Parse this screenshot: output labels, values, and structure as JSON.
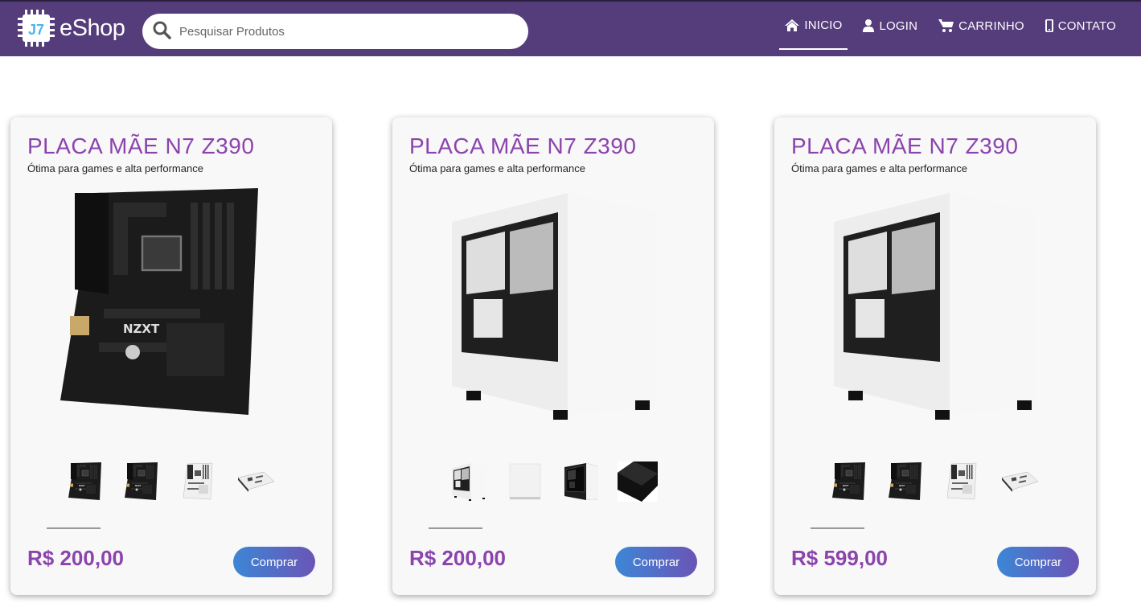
{
  "brand": {
    "logo_letters": "J7",
    "name": "eShop"
  },
  "search": {
    "placeholder": "Pesquisar Produtos",
    "icon": "search-icon"
  },
  "nav": {
    "items": [
      {
        "label": "INICIO",
        "icon": "home-icon",
        "active": true
      },
      {
        "label": "LOGIN",
        "icon": "user-icon",
        "active": false
      },
      {
        "label": "CARRINHO",
        "icon": "cart-icon",
        "active": false
      },
      {
        "label": "CONTATO",
        "icon": "mobile-icon",
        "active": false
      }
    ]
  },
  "colors": {
    "navbar": "#553c7b",
    "accent": "#8b44ad",
    "button_from": "#3d86d6",
    "button_to": "#6a55b6"
  },
  "products": [
    {
      "title": "PLACA MÃE N7 Z390",
      "subtitle": "Ótima para games e alta performance",
      "image": "motherboard-black",
      "thumbnails": [
        "motherboard-black",
        "motherboard-black",
        "motherboard-white",
        "motherboard-white-angle"
      ],
      "price": "R$ 200,00",
      "button": "Comprar"
    },
    {
      "title": "PLACA MÃE N7 Z390",
      "subtitle": "Ótima para games e alta performance",
      "image": "pc-case-white",
      "thumbnails": [
        "pc-case-white",
        "pc-case-white-side",
        "pc-case-black",
        "pc-case-black-angle"
      ],
      "price": "R$ 200,00",
      "button": "Comprar"
    },
    {
      "title": "PLACA MÃE N7 Z390",
      "subtitle": "Ótima para games e alta performance",
      "image": "pc-case-white",
      "thumbnails": [
        "motherboard-black",
        "motherboard-black",
        "motherboard-white",
        "motherboard-white-angle"
      ],
      "price": "R$ 599,00",
      "button": "Comprar"
    }
  ]
}
